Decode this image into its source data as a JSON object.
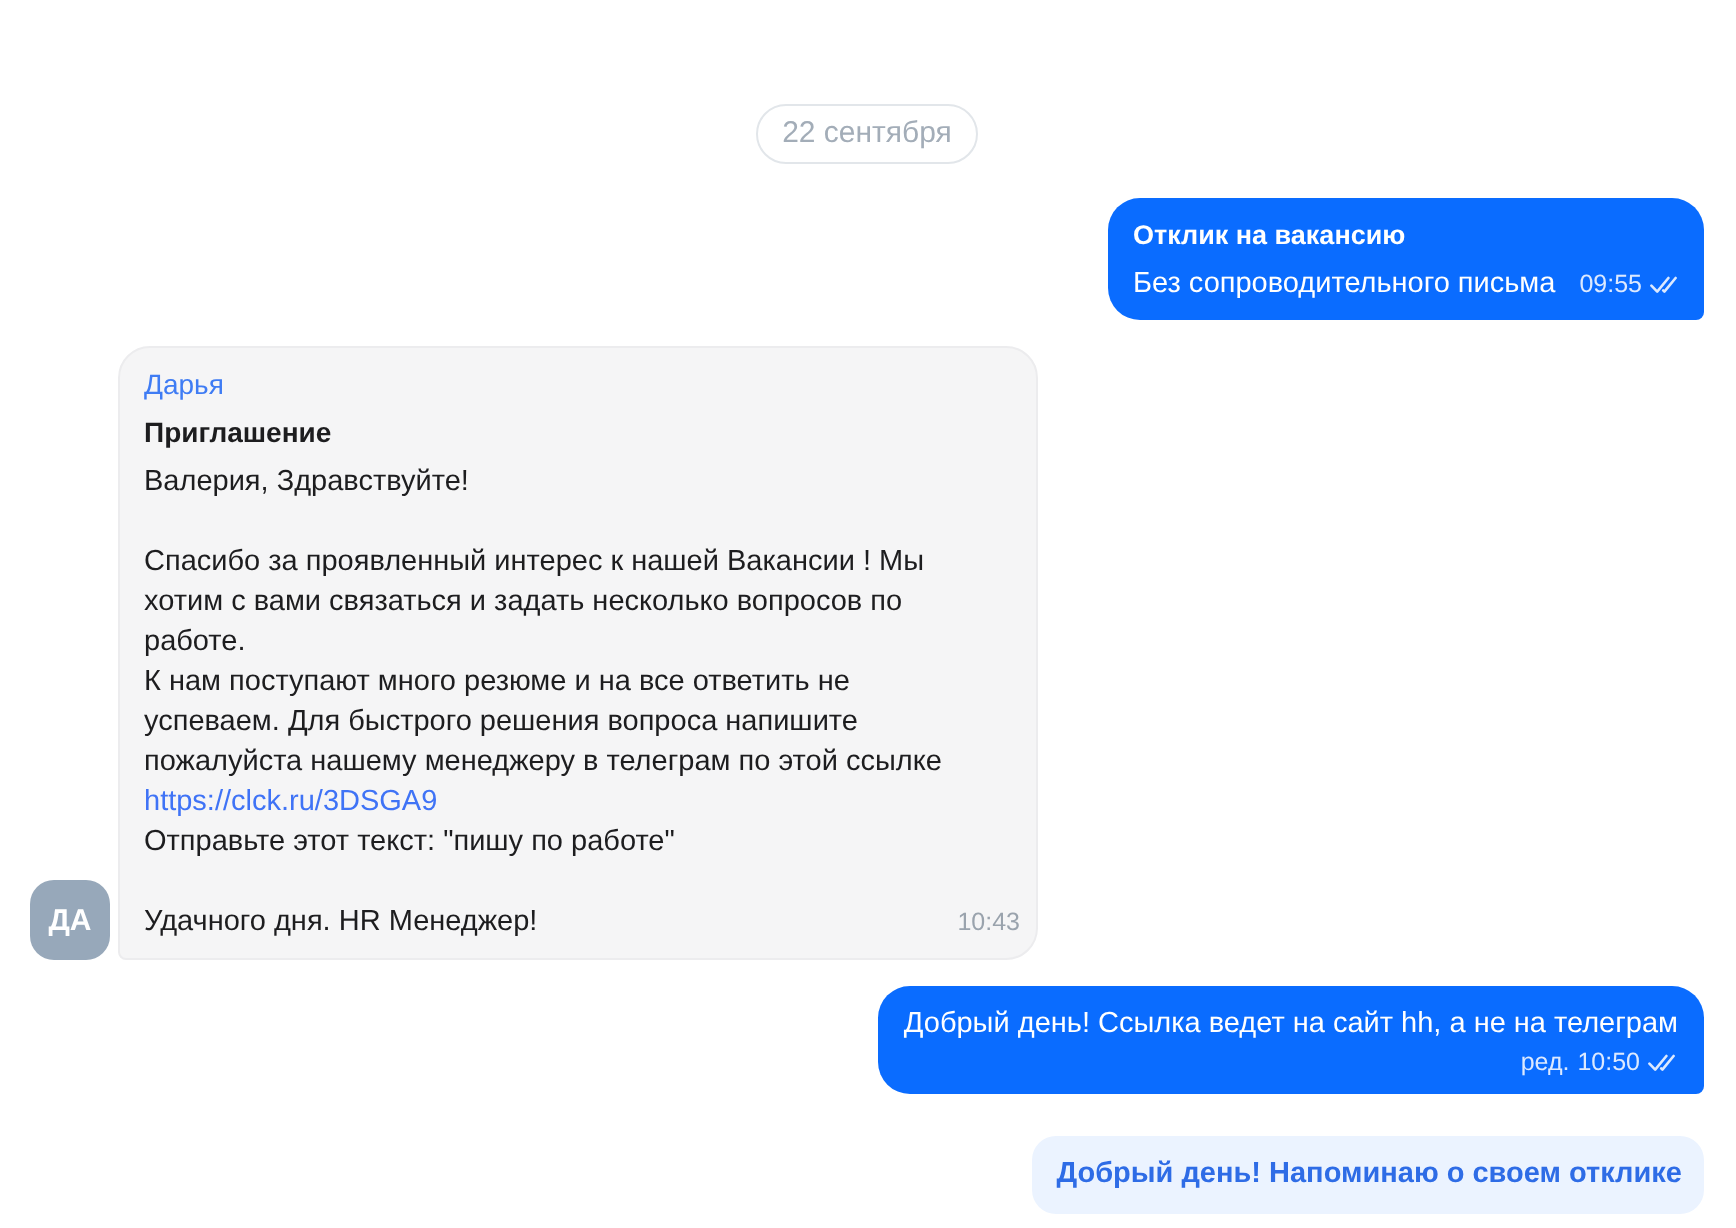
{
  "date_divider": {
    "label": "22 сентября"
  },
  "messages": [
    {
      "kind": "outgoing",
      "title": "Отклик на вакансию",
      "text": "Без сопроводительного письма",
      "time": "09:55",
      "read": true
    },
    {
      "kind": "incoming",
      "avatar": "ДА",
      "sender": "Дарья",
      "title": "Приглашение",
      "blocks": [
        {
          "paragraphs": [
            {
              "kind": "text",
              "text": "Валерия, Здравствуйте!"
            }
          ]
        },
        {
          "paragraphs": [
            {
              "kind": "text",
              "text": "Спасибо за проявленный интерес к нашей Вакансии ! Мы хотим с вами связаться и задать несколько вопросов по работе."
            },
            {
              "kind": "text",
              "text": "К нам поступают много резюме и на все ответить не успеваем. Для быстрого решения вопроса напишите пожалуйста нашему менеджеру в телеграм по этой ссылке"
            },
            {
              "kind": "link",
              "text": "https://clck.ru/3DSGA9"
            },
            {
              "kind": "text",
              "text": "Отправьте этот текст: \"пишу по работе\""
            }
          ]
        },
        {
          "paragraphs": [
            {
              "kind": "text",
              "text": "Удачного дня. HR Менеджер!"
            }
          ]
        }
      ],
      "time": "10:43"
    },
    {
      "kind": "outgoing",
      "text": "Добрый день! Ссылка ведет на сайт hh, а не на телеграм",
      "edited_label": "ред.",
      "time": "10:50",
      "read": true
    },
    {
      "kind": "suggestion",
      "text": "Добрый день! Напоминаю о своем отклике"
    }
  ]
}
